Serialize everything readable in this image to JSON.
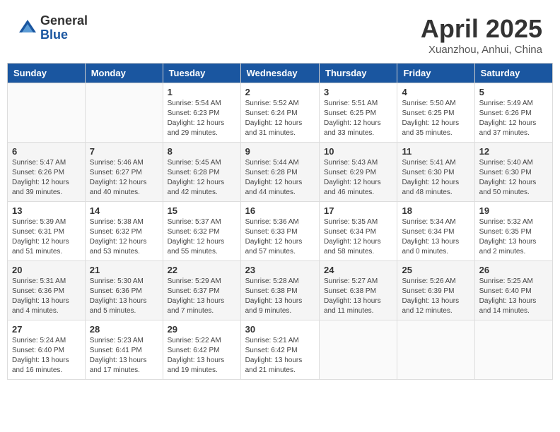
{
  "header": {
    "logo_general": "General",
    "logo_blue": "Blue",
    "month_title": "April 2025",
    "subtitle": "Xuanzhou, Anhui, China"
  },
  "days_of_week": [
    "Sunday",
    "Monday",
    "Tuesday",
    "Wednesday",
    "Thursday",
    "Friday",
    "Saturday"
  ],
  "weeks": [
    [
      {
        "day": "",
        "info": ""
      },
      {
        "day": "",
        "info": ""
      },
      {
        "day": "1",
        "sunrise": "Sunrise: 5:54 AM",
        "sunset": "Sunset: 6:23 PM",
        "daylight": "Daylight: 12 hours and 29 minutes."
      },
      {
        "day": "2",
        "sunrise": "Sunrise: 5:52 AM",
        "sunset": "Sunset: 6:24 PM",
        "daylight": "Daylight: 12 hours and 31 minutes."
      },
      {
        "day": "3",
        "sunrise": "Sunrise: 5:51 AM",
        "sunset": "Sunset: 6:25 PM",
        "daylight": "Daylight: 12 hours and 33 minutes."
      },
      {
        "day": "4",
        "sunrise": "Sunrise: 5:50 AM",
        "sunset": "Sunset: 6:25 PM",
        "daylight": "Daylight: 12 hours and 35 minutes."
      },
      {
        "day": "5",
        "sunrise": "Sunrise: 5:49 AM",
        "sunset": "Sunset: 6:26 PM",
        "daylight": "Daylight: 12 hours and 37 minutes."
      }
    ],
    [
      {
        "day": "6",
        "sunrise": "Sunrise: 5:47 AM",
        "sunset": "Sunset: 6:26 PM",
        "daylight": "Daylight: 12 hours and 39 minutes."
      },
      {
        "day": "7",
        "sunrise": "Sunrise: 5:46 AM",
        "sunset": "Sunset: 6:27 PM",
        "daylight": "Daylight: 12 hours and 40 minutes."
      },
      {
        "day": "8",
        "sunrise": "Sunrise: 5:45 AM",
        "sunset": "Sunset: 6:28 PM",
        "daylight": "Daylight: 12 hours and 42 minutes."
      },
      {
        "day": "9",
        "sunrise": "Sunrise: 5:44 AM",
        "sunset": "Sunset: 6:28 PM",
        "daylight": "Daylight: 12 hours and 44 minutes."
      },
      {
        "day": "10",
        "sunrise": "Sunrise: 5:43 AM",
        "sunset": "Sunset: 6:29 PM",
        "daylight": "Daylight: 12 hours and 46 minutes."
      },
      {
        "day": "11",
        "sunrise": "Sunrise: 5:41 AM",
        "sunset": "Sunset: 6:30 PM",
        "daylight": "Daylight: 12 hours and 48 minutes."
      },
      {
        "day": "12",
        "sunrise": "Sunrise: 5:40 AM",
        "sunset": "Sunset: 6:30 PM",
        "daylight": "Daylight: 12 hours and 50 minutes."
      }
    ],
    [
      {
        "day": "13",
        "sunrise": "Sunrise: 5:39 AM",
        "sunset": "Sunset: 6:31 PM",
        "daylight": "Daylight: 12 hours and 51 minutes."
      },
      {
        "day": "14",
        "sunrise": "Sunrise: 5:38 AM",
        "sunset": "Sunset: 6:32 PM",
        "daylight": "Daylight: 12 hours and 53 minutes."
      },
      {
        "day": "15",
        "sunrise": "Sunrise: 5:37 AM",
        "sunset": "Sunset: 6:32 PM",
        "daylight": "Daylight: 12 hours and 55 minutes."
      },
      {
        "day": "16",
        "sunrise": "Sunrise: 5:36 AM",
        "sunset": "Sunset: 6:33 PM",
        "daylight": "Daylight: 12 hours and 57 minutes."
      },
      {
        "day": "17",
        "sunrise": "Sunrise: 5:35 AM",
        "sunset": "Sunset: 6:34 PM",
        "daylight": "Daylight: 12 hours and 58 minutes."
      },
      {
        "day": "18",
        "sunrise": "Sunrise: 5:34 AM",
        "sunset": "Sunset: 6:34 PM",
        "daylight": "Daylight: 13 hours and 0 minutes."
      },
      {
        "day": "19",
        "sunrise": "Sunrise: 5:32 AM",
        "sunset": "Sunset: 6:35 PM",
        "daylight": "Daylight: 13 hours and 2 minutes."
      }
    ],
    [
      {
        "day": "20",
        "sunrise": "Sunrise: 5:31 AM",
        "sunset": "Sunset: 6:36 PM",
        "daylight": "Daylight: 13 hours and 4 minutes."
      },
      {
        "day": "21",
        "sunrise": "Sunrise: 5:30 AM",
        "sunset": "Sunset: 6:36 PM",
        "daylight": "Daylight: 13 hours and 5 minutes."
      },
      {
        "day": "22",
        "sunrise": "Sunrise: 5:29 AM",
        "sunset": "Sunset: 6:37 PM",
        "daylight": "Daylight: 13 hours and 7 minutes."
      },
      {
        "day": "23",
        "sunrise": "Sunrise: 5:28 AM",
        "sunset": "Sunset: 6:38 PM",
        "daylight": "Daylight: 13 hours and 9 minutes."
      },
      {
        "day": "24",
        "sunrise": "Sunrise: 5:27 AM",
        "sunset": "Sunset: 6:38 PM",
        "daylight": "Daylight: 13 hours and 11 minutes."
      },
      {
        "day": "25",
        "sunrise": "Sunrise: 5:26 AM",
        "sunset": "Sunset: 6:39 PM",
        "daylight": "Daylight: 13 hours and 12 minutes."
      },
      {
        "day": "26",
        "sunrise": "Sunrise: 5:25 AM",
        "sunset": "Sunset: 6:40 PM",
        "daylight": "Daylight: 13 hours and 14 minutes."
      }
    ],
    [
      {
        "day": "27",
        "sunrise": "Sunrise: 5:24 AM",
        "sunset": "Sunset: 6:40 PM",
        "daylight": "Daylight: 13 hours and 16 minutes."
      },
      {
        "day": "28",
        "sunrise": "Sunrise: 5:23 AM",
        "sunset": "Sunset: 6:41 PM",
        "daylight": "Daylight: 13 hours and 17 minutes."
      },
      {
        "day": "29",
        "sunrise": "Sunrise: 5:22 AM",
        "sunset": "Sunset: 6:42 PM",
        "daylight": "Daylight: 13 hours and 19 minutes."
      },
      {
        "day": "30",
        "sunrise": "Sunrise: 5:21 AM",
        "sunset": "Sunset: 6:42 PM",
        "daylight": "Daylight: 13 hours and 21 minutes."
      },
      {
        "day": "",
        "info": ""
      },
      {
        "day": "",
        "info": ""
      },
      {
        "day": "",
        "info": ""
      }
    ]
  ]
}
